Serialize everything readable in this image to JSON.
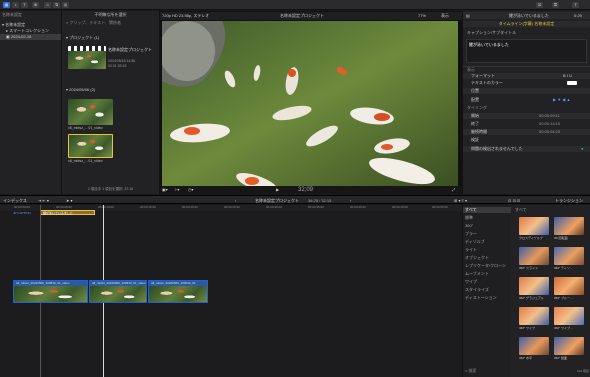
{
  "toolbar": {
    "import": "⊕",
    "keyword": "⌂",
    "bg_task": "⇅",
    "roles": "◎",
    "share_check": "☑",
    "key": "⚿",
    "share": "⇪"
  },
  "sidebar": {
    "header": "名称未設定",
    "items": [
      {
        "label": "名称未設定"
      },
      {
        "label": "スマートコレクション"
      },
      {
        "label": "2024-02-18"
      }
    ]
  },
  "browser": {
    "title": "不明瞭な所を選択",
    "filter": "クリップ、テキスト、関係者",
    "sections": [
      {
        "label": "プロジェクト",
        "count": "(1)"
      },
      {
        "label": "2024/05/06",
        "count": "(2)"
      }
    ],
    "project": {
      "name": "名称未設定プロジェクト",
      "date": "2024/05/18 14:56",
      "duration": "00:01:33:15"
    },
    "clips": [
      {
        "name": "IMG_8061…",
        "label": "x8_mbtsz_…01_video"
      },
      {
        "name": "IMG_8062…",
        "label": "x8_mbtsz_…01_video"
      }
    ],
    "status": "2 項目中 1 項目を選択, 37:16"
  },
  "viewer": {
    "format": "720p HD 23.98p, ステレオ",
    "project": "名称未設定プロジェクト",
    "zoom": "77%",
    "view": "表示",
    "timecode": "32;09"
  },
  "inspector": {
    "title": "鯉が泳いでいるました",
    "time": "0:29",
    "selected": "タイムライン(字幕) 名称未設定",
    "role": "キャプション/サブタイトル",
    "caption": "鯉が泳いでいるました",
    "section": "表示",
    "rows": [
      {
        "label": "フォーマット",
        "value": "B I U"
      },
      {
        "label": "テキストのカラー",
        "value": ""
      },
      {
        "label": "位置",
        "value": ""
      },
      {
        "label": "配置",
        "value": ""
      },
      {
        "label": "タイミング",
        "value": ""
      },
      {
        "label": "開始",
        "value": "00:00:09:11"
      },
      {
        "label": "終了",
        "value": "00:00:14:10"
      },
      {
        "label": "継続時間",
        "value": "00:00:04:23"
      },
      {
        "label": "検証",
        "value": ""
      },
      {
        "label": "問題の検出されませんでした",
        "value": ""
      }
    ]
  },
  "timeline": {
    "index": "インデックス",
    "project": "名称未設定プロジェクト",
    "duration": "36:25 / 32:15",
    "ruler": [
      "00:00:00:00",
      "00:00:05:00",
      "00:00:10:00",
      "00:00:15:00",
      "00:00:20:00",
      "00:00:25:00",
      "00:00:30:00",
      "00:00:35:00",
      "00:00:40:00",
      "00:00:45:00",
      "00:00:50:00"
    ],
    "caption_clip": "鯉が泳いでいるました",
    "clips": [
      {
        "label": "x8_mbtsz_20240506_103834_01_video"
      },
      {
        "label": "x8_mbtsz_20240506_103933_01_video"
      },
      {
        "label": "x8_mbtsz_20240506_104044_01"
      }
    ]
  },
  "transitions": {
    "title": "トランジション",
    "search": "検索",
    "count": "104 項目",
    "categories": [
      "すべて",
      "標準",
      "360°",
      "ブラー",
      "ディゾルブ",
      "ライト",
      "オブジェクト",
      "レプリケータ/クローン",
      "ムーブメント",
      "ワイプ",
      "スタイライズ",
      "ディストーション"
    ],
    "all_label": "すべて",
    "items": [
      {
        "label": "クロスディゾルブ"
      },
      {
        "label": "3D 回転面"
      },
      {
        "label": "360° スライド"
      },
      {
        "label": "360° ディソ..."
      },
      {
        "label": "360° グラジュアル"
      },
      {
        "label": "360° ブルー..."
      },
      {
        "label": "360° ワイプ"
      },
      {
        "label": "360° ワイプ..."
      },
      {
        "label": "360° 水平"
      },
      {
        "label": "360° 鏡面"
      }
    ]
  }
}
